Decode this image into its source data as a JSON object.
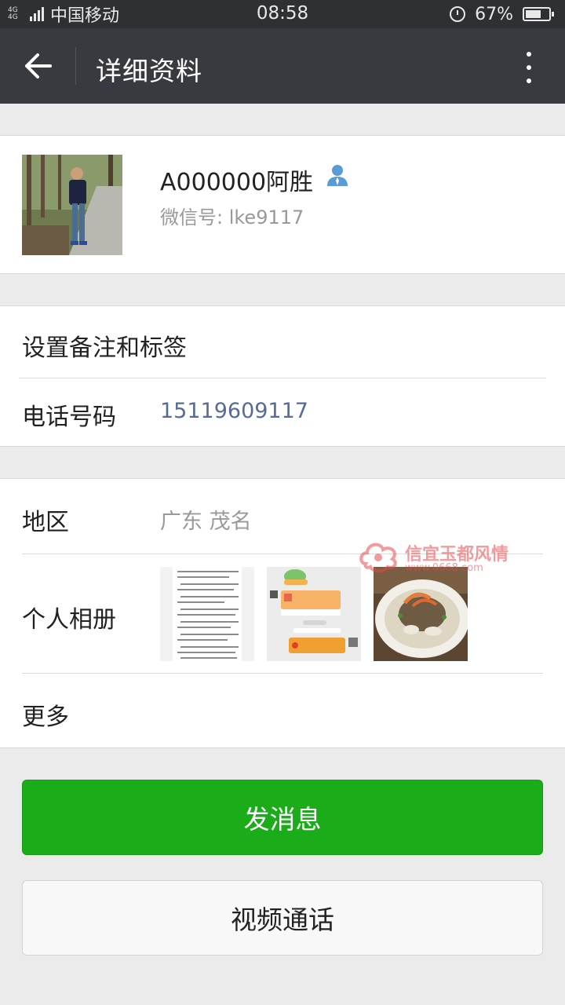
{
  "status_bar": {
    "network": "4G 4G",
    "carrier": "中国移动",
    "time": "08:58",
    "battery": "67%",
    "battery_level": 0.67
  },
  "header": {
    "title": "详细资料",
    "back_icon": "arrow-left-icon",
    "more_icon": "more-vertical-icon"
  },
  "profile": {
    "name": "A000000阿胜",
    "wechat_id": "微信号: lke9117",
    "contact_icon": "user-icon",
    "icon_color": "#5b9bd5"
  },
  "info": {
    "remark_label": "设置备注和标签",
    "phone_label": "电话号码",
    "phone_value": "15119609117",
    "phone_color": "#576b95"
  },
  "details": {
    "region_label": "地区",
    "region_value": "广东  茂名",
    "album_label": "个人相册",
    "more_label": "更多"
  },
  "watermark": {
    "text": "信宜玉都风情",
    "url": "www.0668.com"
  },
  "actions": {
    "send_message": "发消息",
    "video_call": "视频通话"
  },
  "colors": {
    "primary_green": "#1aad19",
    "titlebar": "#393a3f",
    "statusbar": "#2f3033"
  }
}
